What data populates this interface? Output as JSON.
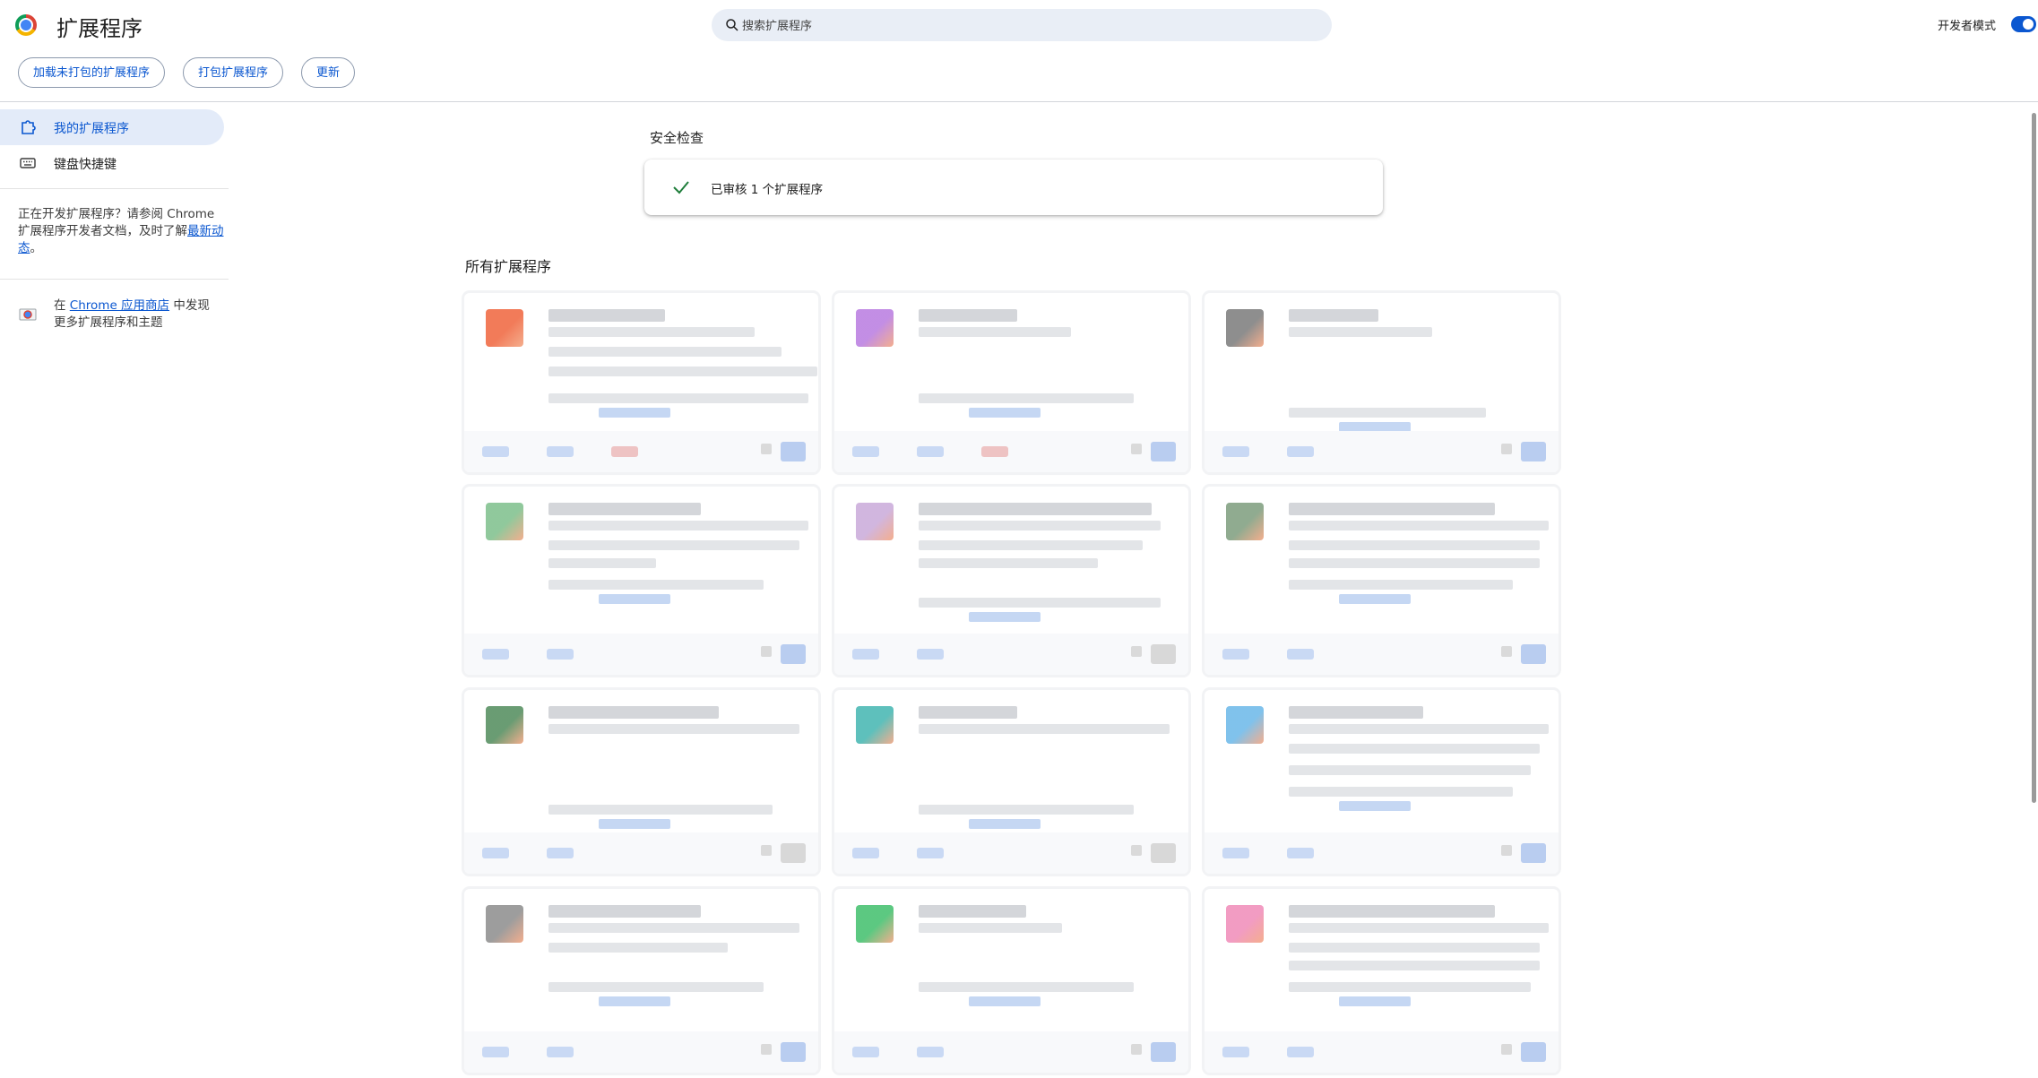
{
  "header": {
    "title": "扩展程序",
    "search_placeholder": "搜索扩展程序",
    "devmode_label": "开发者模式",
    "devmode_on": true
  },
  "toolbar": {
    "load_unpacked": "加载未打包的扩展程序",
    "pack": "打包扩展程序",
    "update": "更新"
  },
  "sidebar": {
    "items": [
      {
        "label": "我的扩展程序",
        "icon": "extension-icon",
        "active": true
      },
      {
        "label": "键盘快捷键",
        "icon": "keyboard-icon",
        "active": false
      }
    ],
    "dev_note_prefix": "正在开发扩展程序？请参阅 Chrome 扩展程序开发者文档，及时了解",
    "dev_note_link": "最新动态",
    "dev_note_suffix": "。",
    "store_prefix": "在 ",
    "store_link": "Chrome 应用商店",
    "store_suffix": " 中发现更多扩展程序和主题"
  },
  "safety": {
    "title": "安全检查",
    "text": "已审核 1 个扩展程序"
  },
  "all_title": "所有扩展程序",
  "colors": {
    "accent": "#0b57d0",
    "active_bg": "#e3ebf9",
    "search_bg": "#e9eef6"
  },
  "cards": [
    {
      "icon_color": "#f0643c",
      "footer_buttons": 3,
      "toggle_on": true
    },
    {
      "icon_color": "#b87ae0",
      "footer_buttons": 3,
      "toggle_on": true
    },
    {
      "icon_color": "#7a7a7a",
      "footer_buttons": 2,
      "toggle_on": true
    },
    {
      "icon_color": "#7dbf8a",
      "footer_buttons": 2,
      "toggle_on": true
    },
    {
      "icon_color": "#c9a9d9",
      "footer_buttons": 2,
      "toggle_on": false
    },
    {
      "icon_color": "#7c9c7c",
      "footer_buttons": 2,
      "toggle_on": true
    },
    {
      "icon_color": "#4f8a5a",
      "footer_buttons": 2,
      "toggle_on": false
    },
    {
      "icon_color": "#41b5b0",
      "footer_buttons": 2,
      "toggle_on": false
    },
    {
      "icon_color": "#6ab7e8",
      "footer_buttons": 2,
      "toggle_on": true
    },
    {
      "icon_color": "#8c8c8c",
      "footer_buttons": 2,
      "toggle_on": true
    },
    {
      "icon_color": "#3fbf6b",
      "footer_buttons": 2,
      "toggle_on": true
    },
    {
      "icon_color": "#f08ab8",
      "footer_buttons": 2,
      "toggle_on": true
    }
  ]
}
